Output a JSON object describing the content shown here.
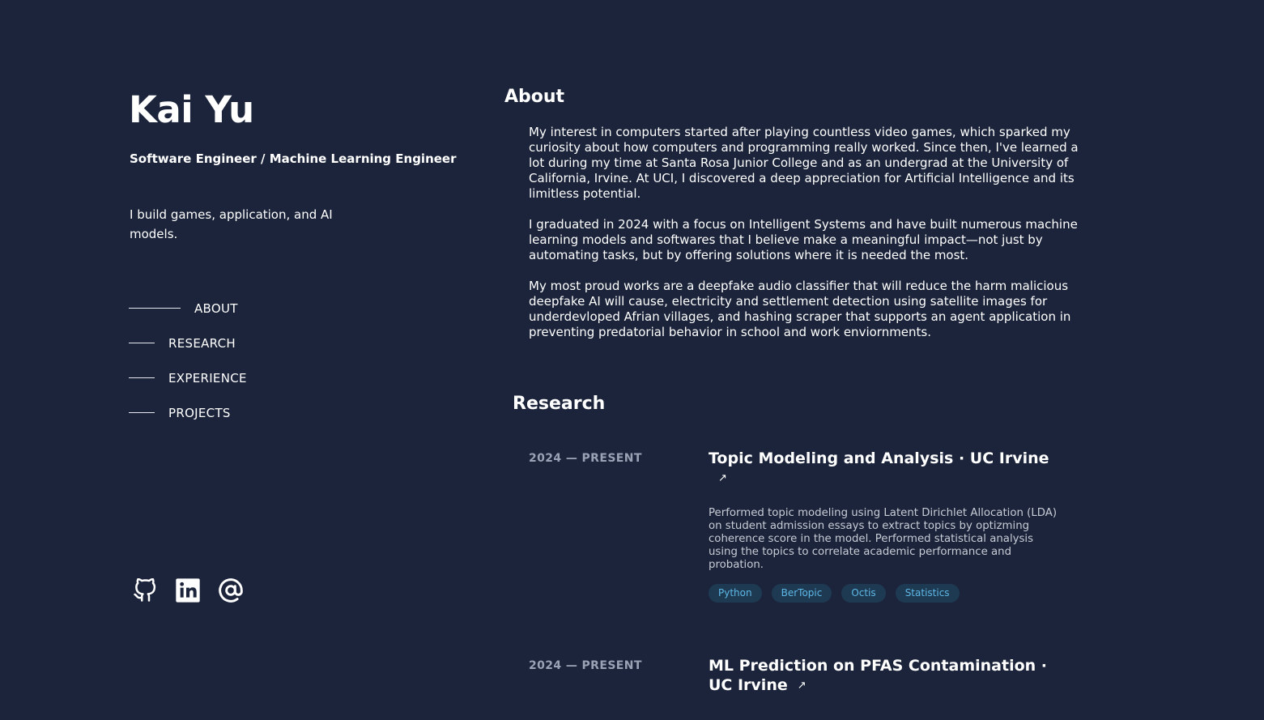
{
  "header": {
    "name": "Kai Yu",
    "role": "Software Engineer / Machine Learning Engineer",
    "tagline": "I build games, application, and AI models."
  },
  "nav": {
    "items": [
      {
        "label": "ABOUT",
        "active": true
      },
      {
        "label": "RESEARCH",
        "active": false
      },
      {
        "label": "EXPERIENCE",
        "active": false
      },
      {
        "label": "PROJECTS",
        "active": false
      }
    ]
  },
  "socials": [
    {
      "icon": "github-icon"
    },
    {
      "icon": "linkedin-icon"
    },
    {
      "icon": "at-sign-icon"
    }
  ],
  "about": {
    "title": "About",
    "paragraphs": [
      "My interest in computers started after playing countless video games, which sparked my curiosity about how computers and programming really worked. Since then, I've learned a lot during my time at Santa Rosa Junior College and as an undergrad at the University of California, Irvine. At UCI, I discovered a deep appreciation for Artificial Intelligence and its limitless potential.",
      "I graduated in 2024 with a focus on Intelligent Systems and have built numerous machine learning models and softwares that I believe make a meaningful impact—not just by automating tasks, but by offering solutions where it is needed the most.",
      "My most proud works are a deepfake audio classifier that will reduce the harm malicious deepfake AI will cause, electricity and settlement detection using satellite images for underdevloped Afrian villages, and hashing scraper that supports an agent application in preventing predatorial behavior in school and work enviornments."
    ]
  },
  "research": {
    "title": "Research",
    "entries": [
      {
        "date": "2024 — PRESENT",
        "title": "Topic Modeling and Analysis · UC Irvine",
        "arrow": "↗",
        "description": "Performed topic modeling using Latent Dirichlet Allocation (LDA) on student admission essays to extract topics by optizming coherence score in the model. Performed statistical analysis using the topics to correlate academic performance and probation.",
        "tags": [
          "Python",
          "BerTopic",
          "Octis",
          "Statistics"
        ]
      },
      {
        "date": "2024 — PRESENT",
        "title": "ML Prediction on PFAS Contamination · UC Irvine",
        "arrow": "↗"
      }
    ]
  }
}
